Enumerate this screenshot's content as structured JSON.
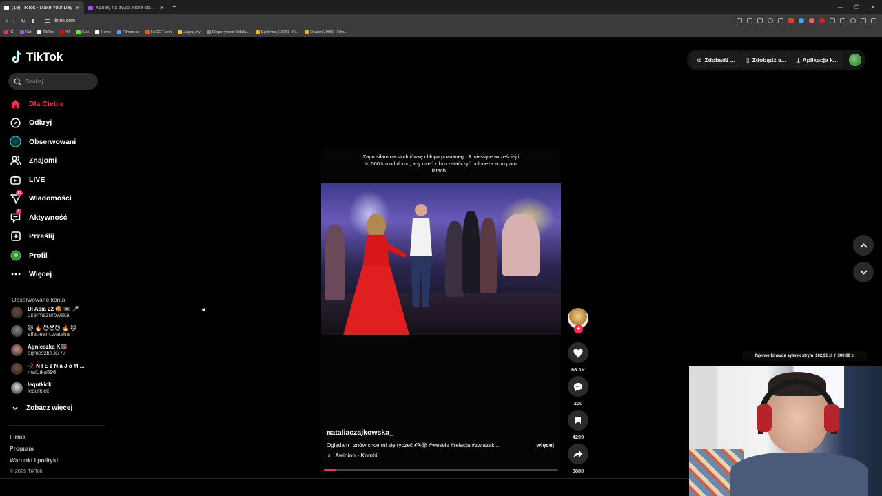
{
  "browser": {
    "tabs": [
      {
        "title": "(18) TikTok - Make Your Day",
        "active": true
      },
      {
        "title": "Kanały na żywo, które obserwujesz -",
        "active": false
      }
    ],
    "new_tab": "+",
    "url": "tiktok.com",
    "bookmarks": [
      {
        "label": "IG",
        "color": "#e1306c"
      },
      {
        "label": "Rat",
        "color": "#9b59e6"
      },
      {
        "label": "TikTok",
        "color": "#ffffff"
      },
      {
        "label": "YT",
        "color": "#ff0000"
      },
      {
        "label": "Kick",
        "color": "#53fc18"
      },
      {
        "label": "Home",
        "color": "#ffffff"
      },
      {
        "label": "Filman.cc",
        "color": "#4aa3ff"
      },
      {
        "label": "FACEIT.com",
        "color": "#ff5500"
      },
      {
        "label": "Zagraj.my",
        "color": "#f0c040"
      },
      {
        "label": "Eksperyment: Odsła...",
        "color": "#888888"
      },
      {
        "label": "Epidemia (1995) - Fi...",
        "color": "#f0b020"
      },
      {
        "label": "Dealer (1998) - Film...",
        "color": "#f0b020"
      }
    ]
  },
  "tiktok": {
    "logo": "TikTok",
    "search_placeholder": "Szukaj",
    "menu": [
      {
        "label": "Dla Ciebie",
        "icon": "home-icon",
        "active": true,
        "badge": ""
      },
      {
        "label": "Odkryj",
        "icon": "compass-icon",
        "active": false,
        "badge": ""
      },
      {
        "label": "Obserwowani",
        "icon": "following-icon",
        "active": false,
        "badge": ""
      },
      {
        "label": "Znajomi",
        "icon": "friends-icon",
        "active": false,
        "badge": ""
      },
      {
        "label": "LIVE",
        "icon": "live-icon",
        "active": false,
        "badge": ""
      },
      {
        "label": "Wiadomości",
        "icon": "messages-icon",
        "active": false,
        "badge": "17"
      },
      {
        "label": "Aktywność",
        "icon": "activity-icon",
        "active": false,
        "badge": "1"
      },
      {
        "label": "Prześlij",
        "icon": "upload-icon",
        "active": false,
        "badge": ""
      },
      {
        "label": "Profil",
        "icon": "profile-icon",
        "active": false,
        "badge": ""
      },
      {
        "label": "Więcej",
        "icon": "more-icon",
        "active": false,
        "badge": ""
      }
    ],
    "followed_title": "Obserwowane konta",
    "followed": [
      {
        "name": "Dj Asia 22 🤩 📼 🎤",
        "handle": "usermazurowska",
        "color": "#6b4a3a"
      },
      {
        "name": "🐱 🔥 😈😈😈 🔥 🐱",
        "handle": "alfa.team.wataha",
        "color": "#888888"
      },
      {
        "name": "Agnieszka K🐻",
        "handle": "agnieszka.k777",
        "color": "#c89080"
      },
      {
        "name": "🥀 N I E z N a J o M ...",
        "handle": "malutka596",
        "color": "#7a5040"
      },
      {
        "name": "lequtkick",
        "handle": "lequtkick",
        "color": "#dddddd"
      }
    ],
    "see_more": "Zobacz więcej",
    "footer": [
      "Firma",
      "Program",
      "Warunki i polityki"
    ],
    "copyright": "© 2025 TikTok",
    "top_buttons": [
      "Zdobądź ...",
      "Zdobądź a...",
      "Aplikacja k..."
    ],
    "video": {
      "overlay_text": "Zaprosiłam na studniówkę chłopa poznanego 3 miesiące wcześniej i to 500 km od domu, aby mieć z kim zatańczyć poloneza a po paru latach...",
      "username": "nataliaczajkowska_",
      "description": "Oglądam i znów chce mi się ryczeć 🫶🏻😭 #wesele #relacja #zwiazek ...",
      "more": "więcej",
      "music": "Awinion - Kombii",
      "progress": 0.05,
      "likes": "66.3K",
      "comments": "200",
      "saves": "4299",
      "shares": "3880"
    }
  },
  "stream": {
    "donation_text": "fajerwerki wuda sylwek strym",
    "donation_current": "102,91 zł",
    "donation_sep": "/",
    "donation_goal": "300,00 zł"
  }
}
